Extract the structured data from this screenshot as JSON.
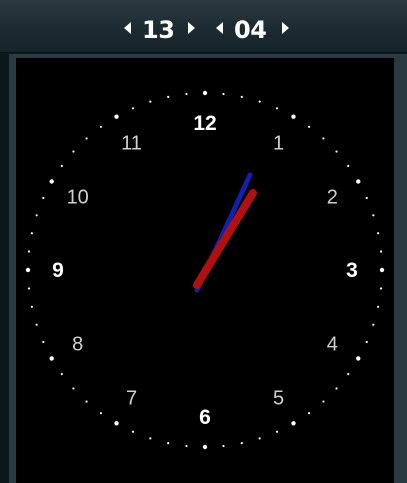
{
  "time_picker": {
    "hour": "13",
    "minute": "04"
  },
  "clock": {
    "numbers": [
      "12",
      "1",
      "2",
      "3",
      "4",
      "5",
      "6",
      "7",
      "8",
      "9",
      "10",
      "11"
    ],
    "hour_hand_color": "#b01010",
    "minute_hand_color": "#1020b0"
  }
}
